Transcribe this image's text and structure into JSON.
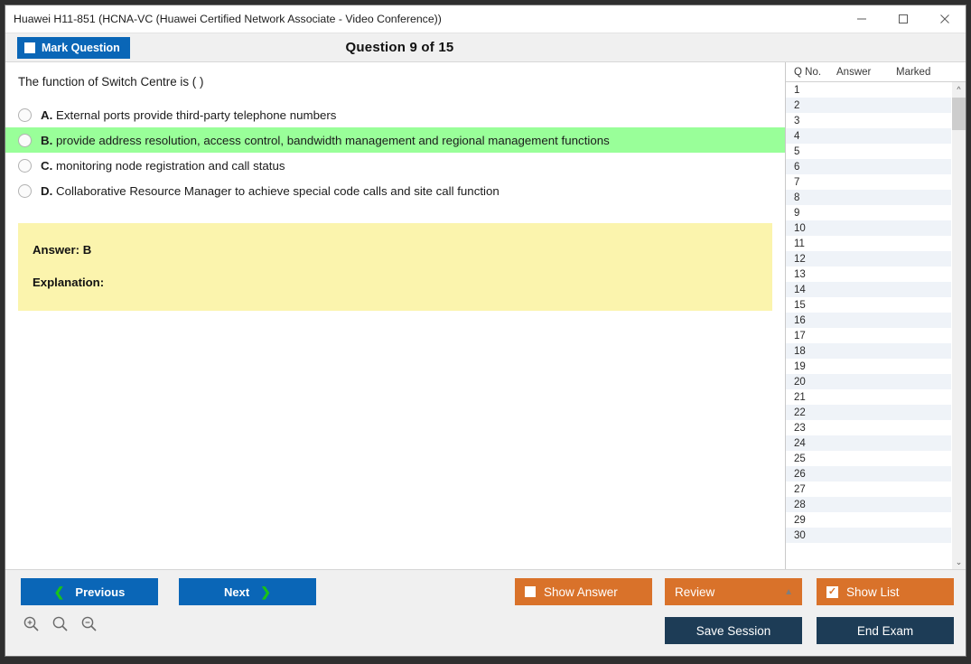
{
  "window": {
    "title": "Huawei H11-851 (HCNA-VC (Huawei Certified Network Associate - Video Conference))",
    "minimize_label": "minimize",
    "maximize_label": "maximize",
    "close_label": "close"
  },
  "header": {
    "mark_question_label": "Mark Question",
    "question_counter": "Question 9 of 15"
  },
  "question": {
    "text": "The function of Switch Centre is ( )",
    "options": [
      {
        "letter": "A.",
        "text": "External ports provide third-party telephone numbers",
        "correct": false
      },
      {
        "letter": "B.",
        "text": "provide address resolution, access control, bandwidth management and regional management functions",
        "correct": true
      },
      {
        "letter": "C.",
        "text": "monitoring node registration and call status",
        "correct": false
      },
      {
        "letter": "D.",
        "text": "Collaborative Resource Manager to achieve special code calls and site call function",
        "correct": false
      }
    ]
  },
  "answer_box": {
    "answer_label": "Answer: B",
    "explanation_label": "Explanation:"
  },
  "question_list": {
    "columns": [
      "Q No.",
      "Answer",
      "Marked"
    ],
    "rows": [
      {
        "no": "1",
        "answer": "",
        "marked": ""
      },
      {
        "no": "2",
        "answer": "",
        "marked": ""
      },
      {
        "no": "3",
        "answer": "",
        "marked": ""
      },
      {
        "no": "4",
        "answer": "",
        "marked": ""
      },
      {
        "no": "5",
        "answer": "",
        "marked": ""
      },
      {
        "no": "6",
        "answer": "",
        "marked": ""
      },
      {
        "no": "7",
        "answer": "",
        "marked": ""
      },
      {
        "no": "8",
        "answer": "",
        "marked": ""
      },
      {
        "no": "9",
        "answer": "",
        "marked": ""
      },
      {
        "no": "10",
        "answer": "",
        "marked": ""
      },
      {
        "no": "11",
        "answer": "",
        "marked": ""
      },
      {
        "no": "12",
        "answer": "",
        "marked": ""
      },
      {
        "no": "13",
        "answer": "",
        "marked": ""
      },
      {
        "no": "14",
        "answer": "",
        "marked": ""
      },
      {
        "no": "15",
        "answer": "",
        "marked": ""
      },
      {
        "no": "16",
        "answer": "",
        "marked": ""
      },
      {
        "no": "17",
        "answer": "",
        "marked": ""
      },
      {
        "no": "18",
        "answer": "",
        "marked": ""
      },
      {
        "no": "19",
        "answer": "",
        "marked": ""
      },
      {
        "no": "20",
        "answer": "",
        "marked": ""
      },
      {
        "no": "21",
        "answer": "",
        "marked": ""
      },
      {
        "no": "22",
        "answer": "",
        "marked": ""
      },
      {
        "no": "23",
        "answer": "",
        "marked": ""
      },
      {
        "no": "24",
        "answer": "",
        "marked": ""
      },
      {
        "no": "25",
        "answer": "",
        "marked": ""
      },
      {
        "no": "26",
        "answer": "",
        "marked": ""
      },
      {
        "no": "27",
        "answer": "",
        "marked": ""
      },
      {
        "no": "28",
        "answer": "",
        "marked": ""
      },
      {
        "no": "29",
        "answer": "",
        "marked": ""
      },
      {
        "no": "30",
        "answer": "",
        "marked": ""
      }
    ]
  },
  "footer": {
    "previous_label": "Previous",
    "next_label": "Next",
    "show_answer_label": "Show Answer",
    "show_answer_checked": false,
    "review_label": "Review",
    "show_list_label": "Show List",
    "show_list_checked": true,
    "save_session_label": "Save Session",
    "end_exam_label": "End Exam",
    "zoom_in_icon": "zoom-in-icon",
    "zoom_reset_icon": "zoom-reset-icon",
    "zoom_out_icon": "zoom-out-icon"
  },
  "colors": {
    "primary_blue": "#0a66b7",
    "orange": "#d9722a",
    "dark_navy": "#1d3c56",
    "correct_green": "#99ff99",
    "answer_yellow": "#fbf4ad",
    "chevron_green": "#19c219"
  }
}
